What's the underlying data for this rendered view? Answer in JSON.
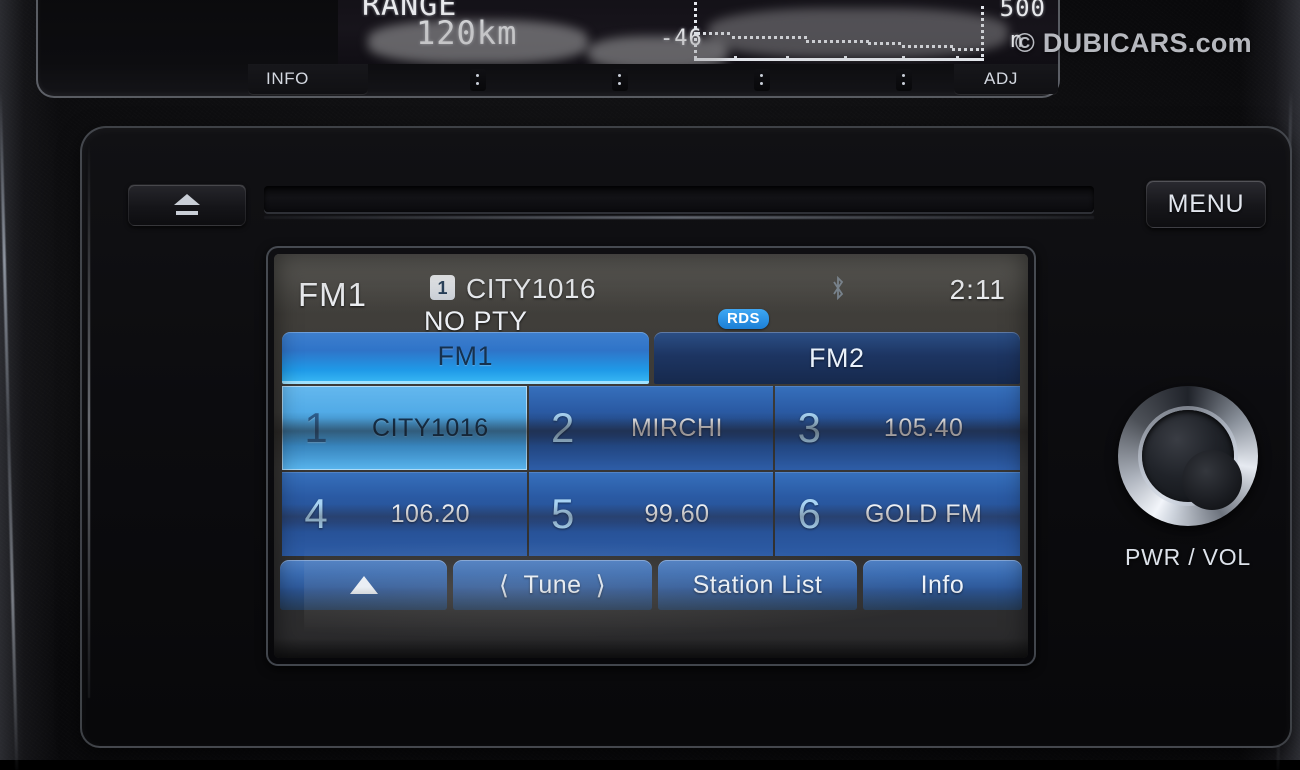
{
  "watermark": "© DUBICARS.com",
  "cluster": {
    "range_label": "RANGE",
    "range_value": "120km",
    "alt_min": "-46",
    "alt_max": "500",
    "alt_unit": "n",
    "info_label": "INFO",
    "adj_label": "ADJ"
  },
  "headunit": {
    "eject_icon": "eject-icon",
    "menu_label": "MENU",
    "power_label": "PWR / VOL"
  },
  "screen": {
    "band": "FM1",
    "preset_number": "1",
    "station_name": "CITY1016",
    "pty": "NO PTY",
    "rds_badge": "RDS",
    "bluetooth_icon": "bluetooth-icon",
    "clock": "2:11",
    "tabs": [
      {
        "label": "FM1",
        "active": true
      },
      {
        "label": "FM2",
        "active": false
      }
    ],
    "presets": [
      {
        "num": "1",
        "name": "CITY1016",
        "selected": true
      },
      {
        "num": "2",
        "name": "MIRCHI",
        "selected": false
      },
      {
        "num": "3",
        "name": "105.40",
        "selected": false
      },
      {
        "num": "4",
        "name": "106.20",
        "selected": false
      },
      {
        "num": "5",
        "name": "99.60",
        "selected": false
      },
      {
        "num": "6",
        "name": "GOLD FM",
        "selected": false
      }
    ],
    "softkeys": [
      {
        "label": "",
        "icon": "up-arrow-icon"
      },
      {
        "label": "Tune",
        "icon": "prev-next-chevrons"
      },
      {
        "label": "Station List",
        "icon": ""
      },
      {
        "label": "Info",
        "icon": ""
      }
    ]
  },
  "colors": {
    "accent_blue": "#3ea8f5",
    "selected_preset": "#58b4ec",
    "tab_active": "#36b4f2",
    "screen_bg": "#2a2a2c"
  }
}
